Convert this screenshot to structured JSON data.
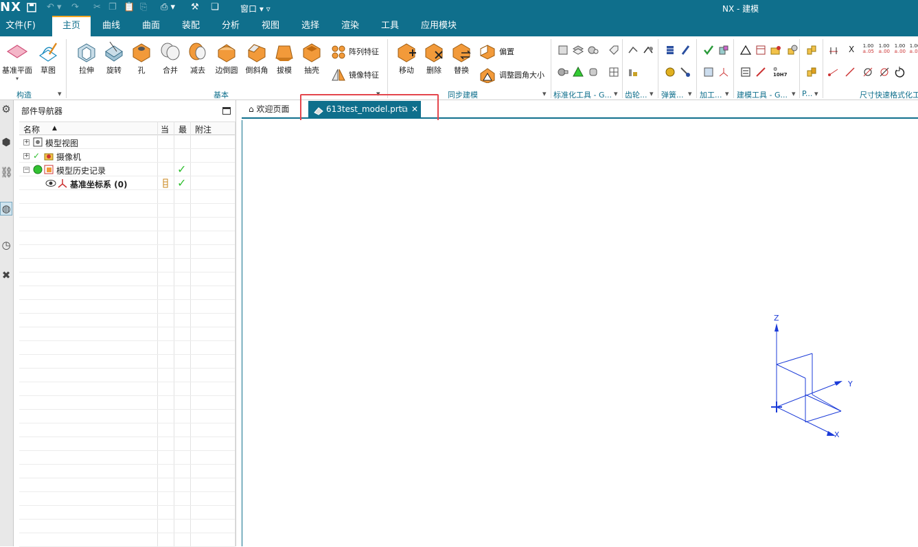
{
  "quick_access": {
    "logo": "NX",
    "window_menu": "窗口",
    "app_title": "NX - 建模"
  },
  "menu": {
    "file": "文件(F)",
    "tabs": [
      "主页",
      "曲线",
      "曲面",
      "装配",
      "分析",
      "视图",
      "选择",
      "渲染",
      "工具",
      "应用模块"
    ]
  },
  "ribbon": {
    "construct": {
      "label": "构造",
      "datum_plane": "基准平面",
      "sketch": "草图"
    },
    "basic": {
      "label": "基本",
      "extrude": "拉伸",
      "revolve": "旋转",
      "hole": "孔",
      "unite": "合并",
      "subtract": "减去",
      "edge_blend": "边倒圆",
      "chamfer": "倒斜角",
      "draft": "拔模",
      "shell": "抽壳",
      "pattern": "阵列特征",
      "mirror": "镜像特征"
    },
    "sync": {
      "label": "同步建模",
      "move": "移动",
      "delete": "删除",
      "replace": "替换",
      "offset": "偏置",
      "resize_blend": "调整圆角大小"
    },
    "groups": {
      "standard": "标准化工具 - G...",
      "gear": "齿轮...",
      "spring": "弹簧...",
      "machining": "加工...",
      "modeling_tools": "建模工具 - G...",
      "p": "P...",
      "dimension": "尺寸快速格式化工"
    },
    "dim_tags": {
      "x": "X",
      "a": "1.00",
      "a2": "±.05",
      "b": "1.00",
      "b2": "±.00",
      "c": "1.00",
      "c2": "±.00",
      "d": "1.00",
      "d2": "±.00"
    }
  },
  "navigator": {
    "title": "部件导航器",
    "columns": {
      "name": "名称",
      "current": "当",
      "latest": "最",
      "note": "附注"
    },
    "rows": [
      {
        "label": "模型视图"
      },
      {
        "label": "摄像机"
      },
      {
        "label": "模型历史记录"
      },
      {
        "label": "基准坐标系 (0)"
      }
    ]
  },
  "tabs": {
    "welcome": "欢迎页面",
    "model": "613test_model.prt"
  },
  "viewport": {
    "axis_x": "X",
    "axis_y": "Y",
    "axis_z": "Z"
  },
  "colors": {
    "brand": "#0f6f8c",
    "accent_orange": "#f5a623",
    "highlight_red": "#e4444b",
    "axis_blue": "#1b3bd8"
  }
}
